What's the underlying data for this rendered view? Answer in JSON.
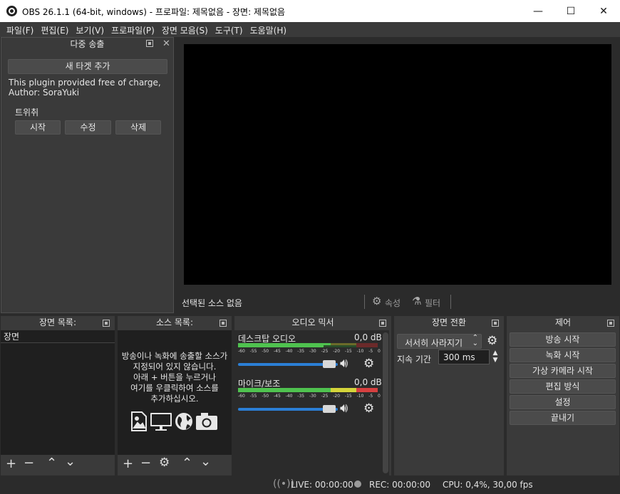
{
  "window": {
    "title": "OBS 26.1.1 (64-bit, windows) - 프로파일: 제목없음 - 장면: 제목없음",
    "minimize": "—",
    "maximize": "☐",
    "close": "✕"
  },
  "menu": [
    "파일(F)",
    "편집(E)",
    "보기(V)",
    "프로파일(P)",
    "장면 모음(S)",
    "도구(T)",
    "도움말(H)"
  ],
  "multistream": {
    "title": "다중 송출",
    "new_target": "새 타겟 추가",
    "plugin_line1": "This plugin provided free of charge,",
    "plugin_line2": "Author: SoraYuki",
    "target_name": "트위취",
    "start": "시작",
    "edit": "수정",
    "delete": "삭제"
  },
  "source_bar": {
    "no_source": "선택된 소스 없음",
    "properties": "속성",
    "filters": "필터"
  },
  "scenes": {
    "title": "장면 목록:",
    "items": [
      "장면"
    ]
  },
  "sources": {
    "title": "소스 목록:",
    "empty_line1": "방송이나 녹화에 송출할 소스가",
    "empty_line2": "지정되어 있지 않습니다.",
    "empty_line3": "아래 + 버튼을 누르거나",
    "empty_line4": "여기를 우클릭하여 소스를",
    "empty_line5": "추가하십시오."
  },
  "mixer": {
    "title": "오디오 믹서",
    "channels": [
      {
        "name": "데스크탑 오디오",
        "db": "0,0 dB",
        "volume": 1.0
      },
      {
        "name": "마이크/보조",
        "db": "0,0 dB",
        "volume": 1.0
      }
    ],
    "scale": [
      "-60",
      "-55",
      "-50",
      "-45",
      "-40",
      "-35",
      "-30",
      "-25",
      "-20",
      "-15",
      "-10",
      "-5",
      "0"
    ]
  },
  "transitions": {
    "title": "장면 전환",
    "selected": "서서히 사라지기",
    "duration_label": "지속 기간",
    "duration_value": "300 ms"
  },
  "controls": {
    "title": "제어",
    "buttons": [
      "방송 시작",
      "녹화 시작",
      "가상 카메라 시작",
      "편집 방식",
      "설정",
      "끝내기"
    ]
  },
  "status": {
    "live": "LIVE: 00:00:00",
    "rec": "REC: 00:00:00",
    "cpu": "CPU: 0,4%, 30,00 fps"
  },
  "colors": {
    "meter_green": "#4fc24f",
    "meter_yellow": "#d4d43a",
    "meter_red": "#d64040",
    "slider_blue": "#2b7fd6"
  }
}
